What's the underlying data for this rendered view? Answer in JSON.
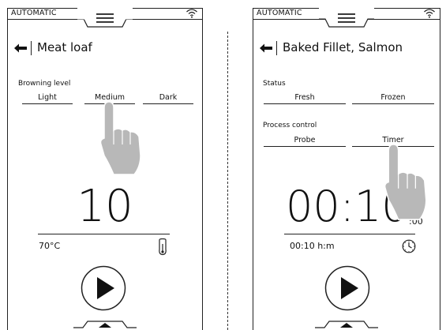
{
  "left": {
    "mode": "AUTOMATIC",
    "title": "Meat loaf",
    "browning_label": "Browning level",
    "browning_options": [
      "Light",
      "Medium",
      "Dark"
    ],
    "value": "10",
    "temperature": "70°C"
  },
  "right": {
    "mode": "AUTOMATIC",
    "title": "Baked Fillet, Salmon",
    "status_label": "Status",
    "status_options": [
      "Fresh",
      "Frozen"
    ],
    "process_label": "Process control",
    "process_options": [
      "Probe",
      "Timer"
    ],
    "time_main": "00:10",
    "time_seconds": ":00",
    "time_readout": "00:10 h:m"
  }
}
